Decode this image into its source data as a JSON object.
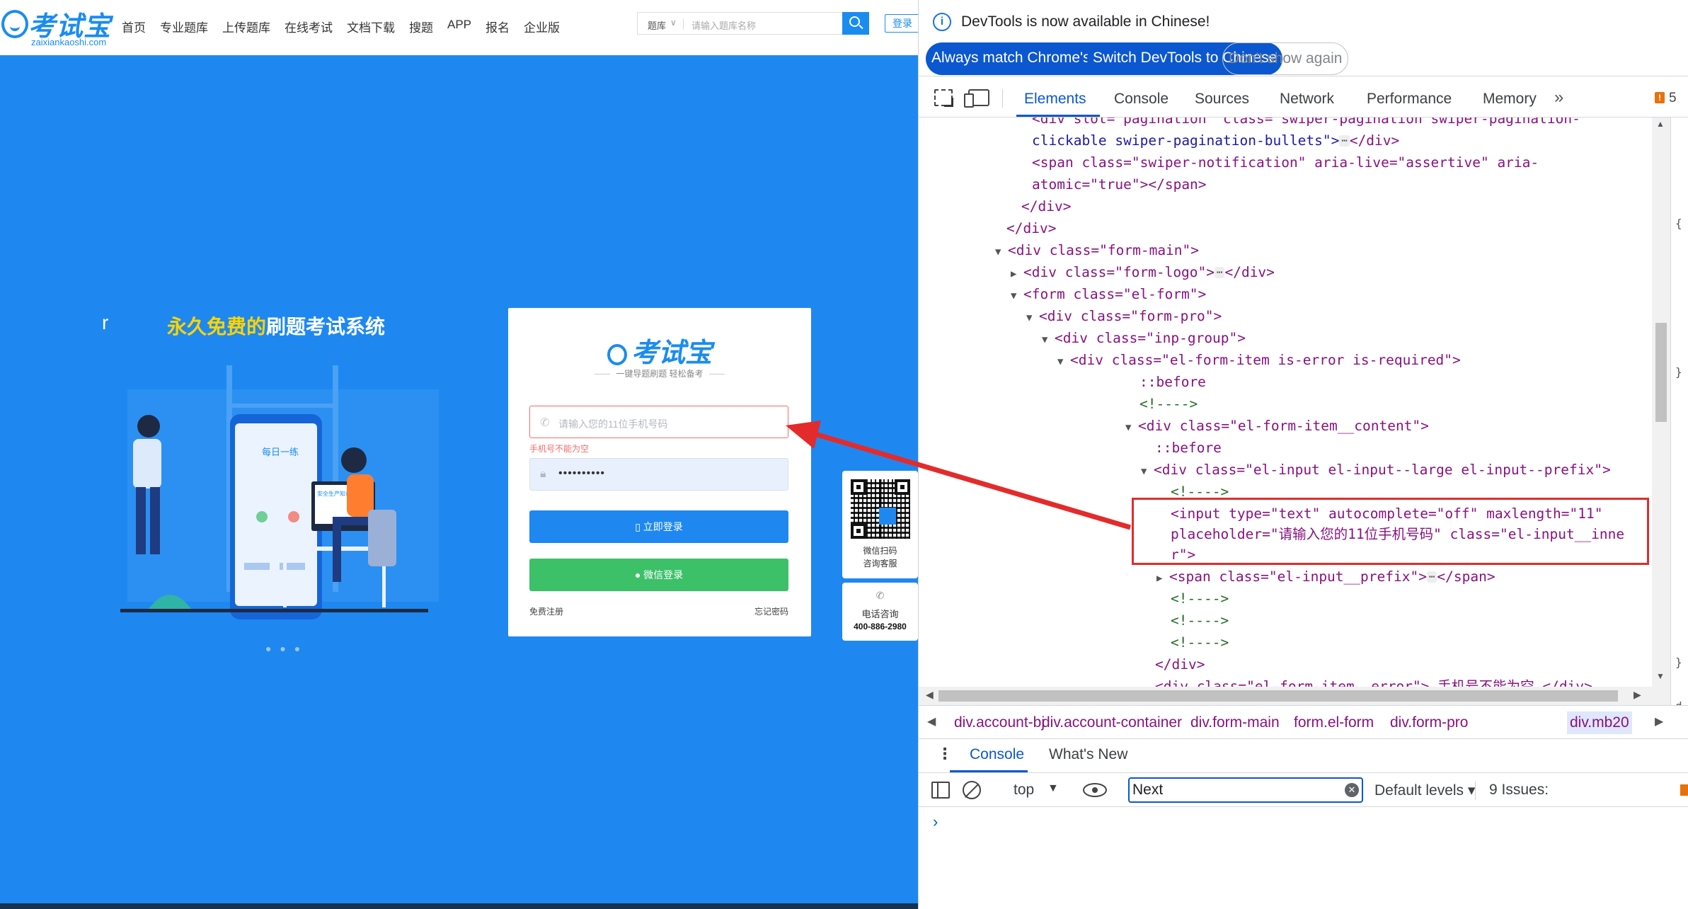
{
  "site": {
    "logo": {
      "name": "考试宝",
      "domain": "zaixiankaoshi.com"
    },
    "nav": [
      "首页",
      "专业题库",
      "上传题库",
      "在线考试",
      "文档下载",
      "搜题",
      "APP",
      "报名",
      "企业版"
    ],
    "search": {
      "category": "题库",
      "placeholder": "请输入题库名称"
    },
    "login_label": "登录",
    "slogan_prefix": "r",
    "slogan_highlight": "永久免费的",
    "slogan_rest": "刷题考试系统",
    "illustration": {
      "card_title": "每日一练",
      "screen_title": "安全生产知识竞赛"
    },
    "carousel_dots": "● ● ●",
    "login_card": {
      "logo": "考试宝",
      "tagline": "一键导题刷题 轻松备考",
      "phone_placeholder": "请输入您的11位手机号码",
      "phone_error": "手机号不能为空",
      "password_value": "••••••••••",
      "login_button": "立即登录",
      "wechat_button": "微信登录",
      "register_link": "免费注册",
      "forgot_link": "忘记密码"
    },
    "qr": {
      "label1": "微信扫码",
      "label2": "咨询客服"
    },
    "tel": {
      "icon": "✆",
      "label": "电话咨询",
      "number": "400-886-2980"
    }
  },
  "devtools": {
    "infobar": {
      "message": "DevTools is now available in Chinese!",
      "btn_match": "Always match Chrome's language",
      "btn_switch": "Switch DevTools to Chinese",
      "btn_dismiss": "Don't show again"
    },
    "tabs": [
      "Elements",
      "Console",
      "Sources",
      "Network",
      "Performance",
      "Memory"
    ],
    "issue_count": "5",
    "dom": {
      "l0": "<div slot=\"pagination\" class=\"swiper-pagination swiper-pagination-",
      "l1": "clickable swiper-pagination-bullets\">",
      "l1b": "</div>",
      "l2": "<span class=\"swiper-notification\" aria-live=\"assertive\" aria-",
      "l3": "atomic=\"true\"></span>",
      "l4": "</div>",
      "l5": "</div>",
      "l6": "<div class=\"form-main\">",
      "l7": "<div class=\"form-logo\">",
      "l7b": "</div>",
      "l8": "<form class=\"el-form\">",
      "l9": "<div class=\"form-pro\">",
      "l10": "<div class=\"inp-group\">",
      "l11": "<div class=\"el-form-item is-error is-required\">",
      "l12": "::before",
      "l13": "<!---->",
      "l14": "<div class=\"el-form-item__content\">",
      "l15": "::before",
      "l16": "<div class=\"el-input el-input--large el-input--prefix\">",
      "l17": "<!---->",
      "l18": "<input type=\"text\" autocomplete=\"off\" maxlength=\"11\"",
      "l19": "placeholder=\"请输入您的11位手机号码\" class=\"el-input__inne",
      "l20": "r\">",
      "l21": "<span class=\"el-input__prefix\">",
      "l21b": "</span>",
      "l22": "<!---->",
      "l23": "<!---->",
      "l24": "<!---->",
      "l25": "</div>",
      "l26": "<div class=\"el-form-item__error\"> 手机号不能为空 </div>"
    },
    "styles_edge": [
      "{",
      "}",
      "}",
      "d"
    ],
    "breadcrumbs": [
      "div.account-bj",
      "div.account-container",
      "div.form-main",
      "form.el-form",
      "div.form-pro",
      "div.mb20"
    ],
    "drawer_tabs": [
      "Console",
      "What's New"
    ],
    "console": {
      "context": "top",
      "filter_value": "Next",
      "levels": "Default levels",
      "issues": "9 Issues:"
    }
  }
}
